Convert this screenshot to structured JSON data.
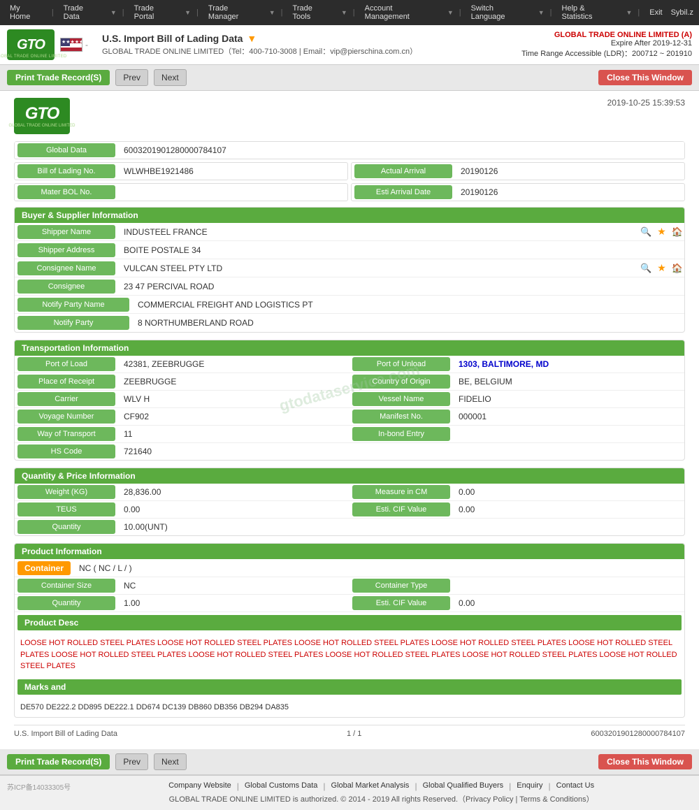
{
  "topnav": {
    "items": [
      "My Home",
      "Trade Data",
      "Trade Portal",
      "Trade Manager",
      "Trade Tools",
      "Account Management",
      "Switch Language",
      "Help & Statistics",
      "Exit"
    ],
    "user": "Sybil.z"
  },
  "header": {
    "logo_text": "GTO",
    "logo_sub": "GLOBAL TRADE ONLINE LIMITED",
    "flag_alt": "US Flag",
    "title": "U.S. Import Bill of Lading Data",
    "contact": "GLOBAL TRADE ONLINE LIMITED（Tel：400-710-3008 | Email：vip@pierschina.com.cn）",
    "company_name": "GLOBAL TRADE ONLINE LIMITED (A)",
    "expire": "Expire After 2019-12-31",
    "time_range": "Time Range Accessible (LDR)：200712 ~ 201910"
  },
  "actions": {
    "print": "Print Trade Record(S)",
    "prev": "Prev",
    "next": "Next",
    "close": "Close This Window"
  },
  "document": {
    "timestamp": "2019-10-25 15:39:53",
    "global_data_label": "Global Data",
    "global_data_value": "6003201901280000784107",
    "bol_label": "Bill of Lading No.",
    "bol_value": "WLWHBE1921486",
    "actual_arrival_label": "Actual Arrival",
    "actual_arrival_value": "20190126",
    "master_bol_label": "Mater BOL No.",
    "master_bol_value": "",
    "esti_arrival_label": "Esti Arrival Date",
    "esti_arrival_value": "20190126"
  },
  "buyer_supplier": {
    "section_title": "Buyer & Supplier Information",
    "shipper_name_label": "Shipper Name",
    "shipper_name_value": "INDUSTEEL FRANCE",
    "shipper_address_label": "Shipper Address",
    "shipper_address_value": "BOITE POSTALE 34",
    "consignee_name_label": "Consignee Name",
    "consignee_name_value": "VULCAN STEEL PTY LTD",
    "consignee_label": "Consignee",
    "consignee_value": "23 47 PERCIVAL ROAD",
    "notify_party_name_label": "Notify Party Name",
    "notify_party_name_value": "COMMERCIAL FREIGHT AND LOGISTICS PT",
    "notify_party_label": "Notify Party",
    "notify_party_value": "8 NORTHUMBERLAND ROAD"
  },
  "transportation": {
    "section_title": "Transportation Information",
    "port_of_load_label": "Port of Load",
    "port_of_load_value": "42381, ZEEBRUGGE",
    "port_of_unload_label": "Port of Unload",
    "port_of_unload_value": "1303, BALTIMORE, MD",
    "place_of_receipt_label": "Place of Receipt",
    "place_of_receipt_value": "ZEEBRUGGE",
    "country_of_origin_label": "Country of Origin",
    "country_of_origin_value": "BE, BELGIUM",
    "carrier_label": "Carrier",
    "carrier_value": "WLV H",
    "vessel_name_label": "Vessel Name",
    "vessel_name_value": "FIDELIO",
    "voyage_number_label": "Voyage Number",
    "voyage_number_value": "CF902",
    "manifest_no_label": "Manifest No.",
    "manifest_no_value": "000001",
    "way_of_transport_label": "Way of Transport",
    "way_of_transport_value": "11",
    "in_bond_entry_label": "In-bond Entry",
    "in_bond_entry_value": "",
    "hs_code_label": "HS Code",
    "hs_code_value": "721640"
  },
  "quantity_price": {
    "section_title": "Quantity & Price Information",
    "weight_label": "Weight (KG)",
    "weight_value": "28,836.00",
    "measure_label": "Measure in CM",
    "measure_value": "0.00",
    "teus_label": "TEUS",
    "teus_value": "0.00",
    "esti_cif_label": "Esti. CIF Value",
    "esti_cif_value": "0.00",
    "quantity_label": "Quantity",
    "quantity_value": "10.00(UNT)"
  },
  "product": {
    "section_title": "Product Information",
    "container_label": "Container",
    "container_value": "NC ( NC / L / )",
    "container_size_label": "Container Size",
    "container_size_value": "NC",
    "container_type_label": "Container Type",
    "container_type_value": "",
    "quantity_label": "Quantity",
    "quantity_value": "1.00",
    "esti_cif_label": "Esti. CIF Value",
    "esti_cif_value": "0.00",
    "product_desc_label": "Product Desc",
    "product_desc_value": "LOOSE HOT ROLLED STEEL PLATES LOOSE HOT ROLLED STEEL PLATES LOOSE HOT ROLLED STEEL PLATES LOOSE HOT ROLLED STEEL PLATES LOOSE HOT ROLLED STEEL PLATES LOOSE HOT ROLLED STEEL PLATES LOOSE HOT ROLLED STEEL PLATES LOOSE HOT ROLLED STEEL PLATES LOOSE HOT ROLLED STEEL PLATES LOOSE HOT ROLLED STEEL PLATES",
    "marks_label": "Marks and",
    "marks_value": "DE570 DE222.2 DD895 DE222.1 DD674 DC139 DB860 DB356 DB294 DA835"
  },
  "doc_footer": {
    "label": "U.S. Import Bill of Lading Data",
    "page": "1 / 1",
    "id": "6003201901280000784107"
  },
  "page_footer": {
    "links": [
      "Company Website",
      "Global Customs Data",
      "Global Market Analysis",
      "Global Qualified Buyers",
      "Enquiry",
      "Contact Us"
    ],
    "copyright": "GLOBAL TRADE ONLINE LIMITED is authorized. © 2014 - 2019 All rights Reserved.（Privacy Policy | Terms & Conditions）",
    "icp": "苏ICP备14033305号"
  },
  "watermark": "gtodataservice.com"
}
